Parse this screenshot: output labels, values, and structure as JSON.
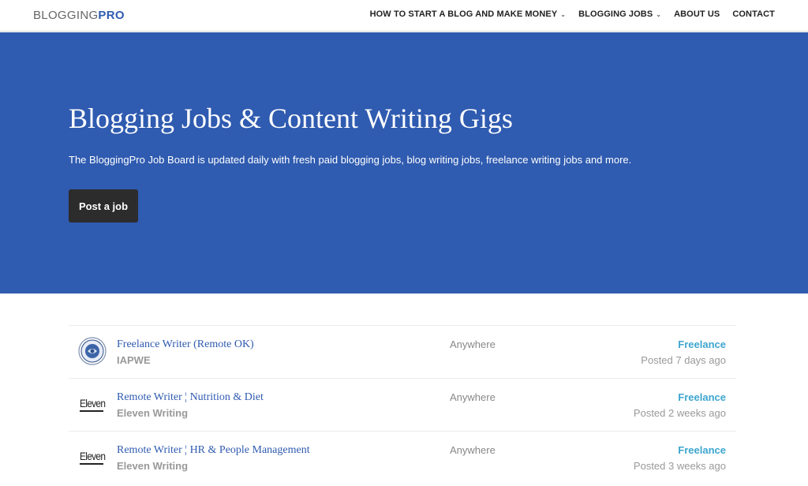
{
  "header": {
    "logo_part1": "BLOGGING",
    "logo_part2": "PRO",
    "nav": [
      {
        "label": "HOW TO START A BLOG AND MAKE MONEY",
        "has_dropdown": true
      },
      {
        "label": "BLOGGING JOBS",
        "has_dropdown": true
      },
      {
        "label": "ABOUT US",
        "has_dropdown": false
      },
      {
        "label": "CONTACT",
        "has_dropdown": false
      }
    ]
  },
  "hero": {
    "title": "Blogging Jobs & Content Writing Gigs",
    "subtitle": "The BloggingPro Job Board is updated daily with fresh paid blogging jobs, blog writing jobs, freelance writing jobs and more.",
    "button_label": "Post a job",
    "background_color": "#2f5bb0"
  },
  "jobs": [
    {
      "title": "Freelance Writer (Remote OK)",
      "company": "IAPWE",
      "location": "Anywhere",
      "type": "Freelance",
      "posted": "Posted 7 days ago",
      "logo_icon": "iapwe-seal-icon"
    },
    {
      "title": "Remote Writer ¦ Nutrition & Diet",
      "company": "Eleven Writing",
      "location": "Anywhere",
      "type": "Freelance",
      "posted": "Posted 2 weeks ago",
      "logo_icon": "eleven-logo-icon"
    },
    {
      "title": "Remote Writer ¦ HR & People Management",
      "company": "Eleven Writing",
      "location": "Anywhere",
      "type": "Freelance",
      "posted": "Posted 3 weeks ago",
      "logo_icon": "eleven-logo-icon"
    }
  ],
  "colors": {
    "accent_blue": "#2f5bb0",
    "freelance_tag": "#3ea6cf"
  }
}
